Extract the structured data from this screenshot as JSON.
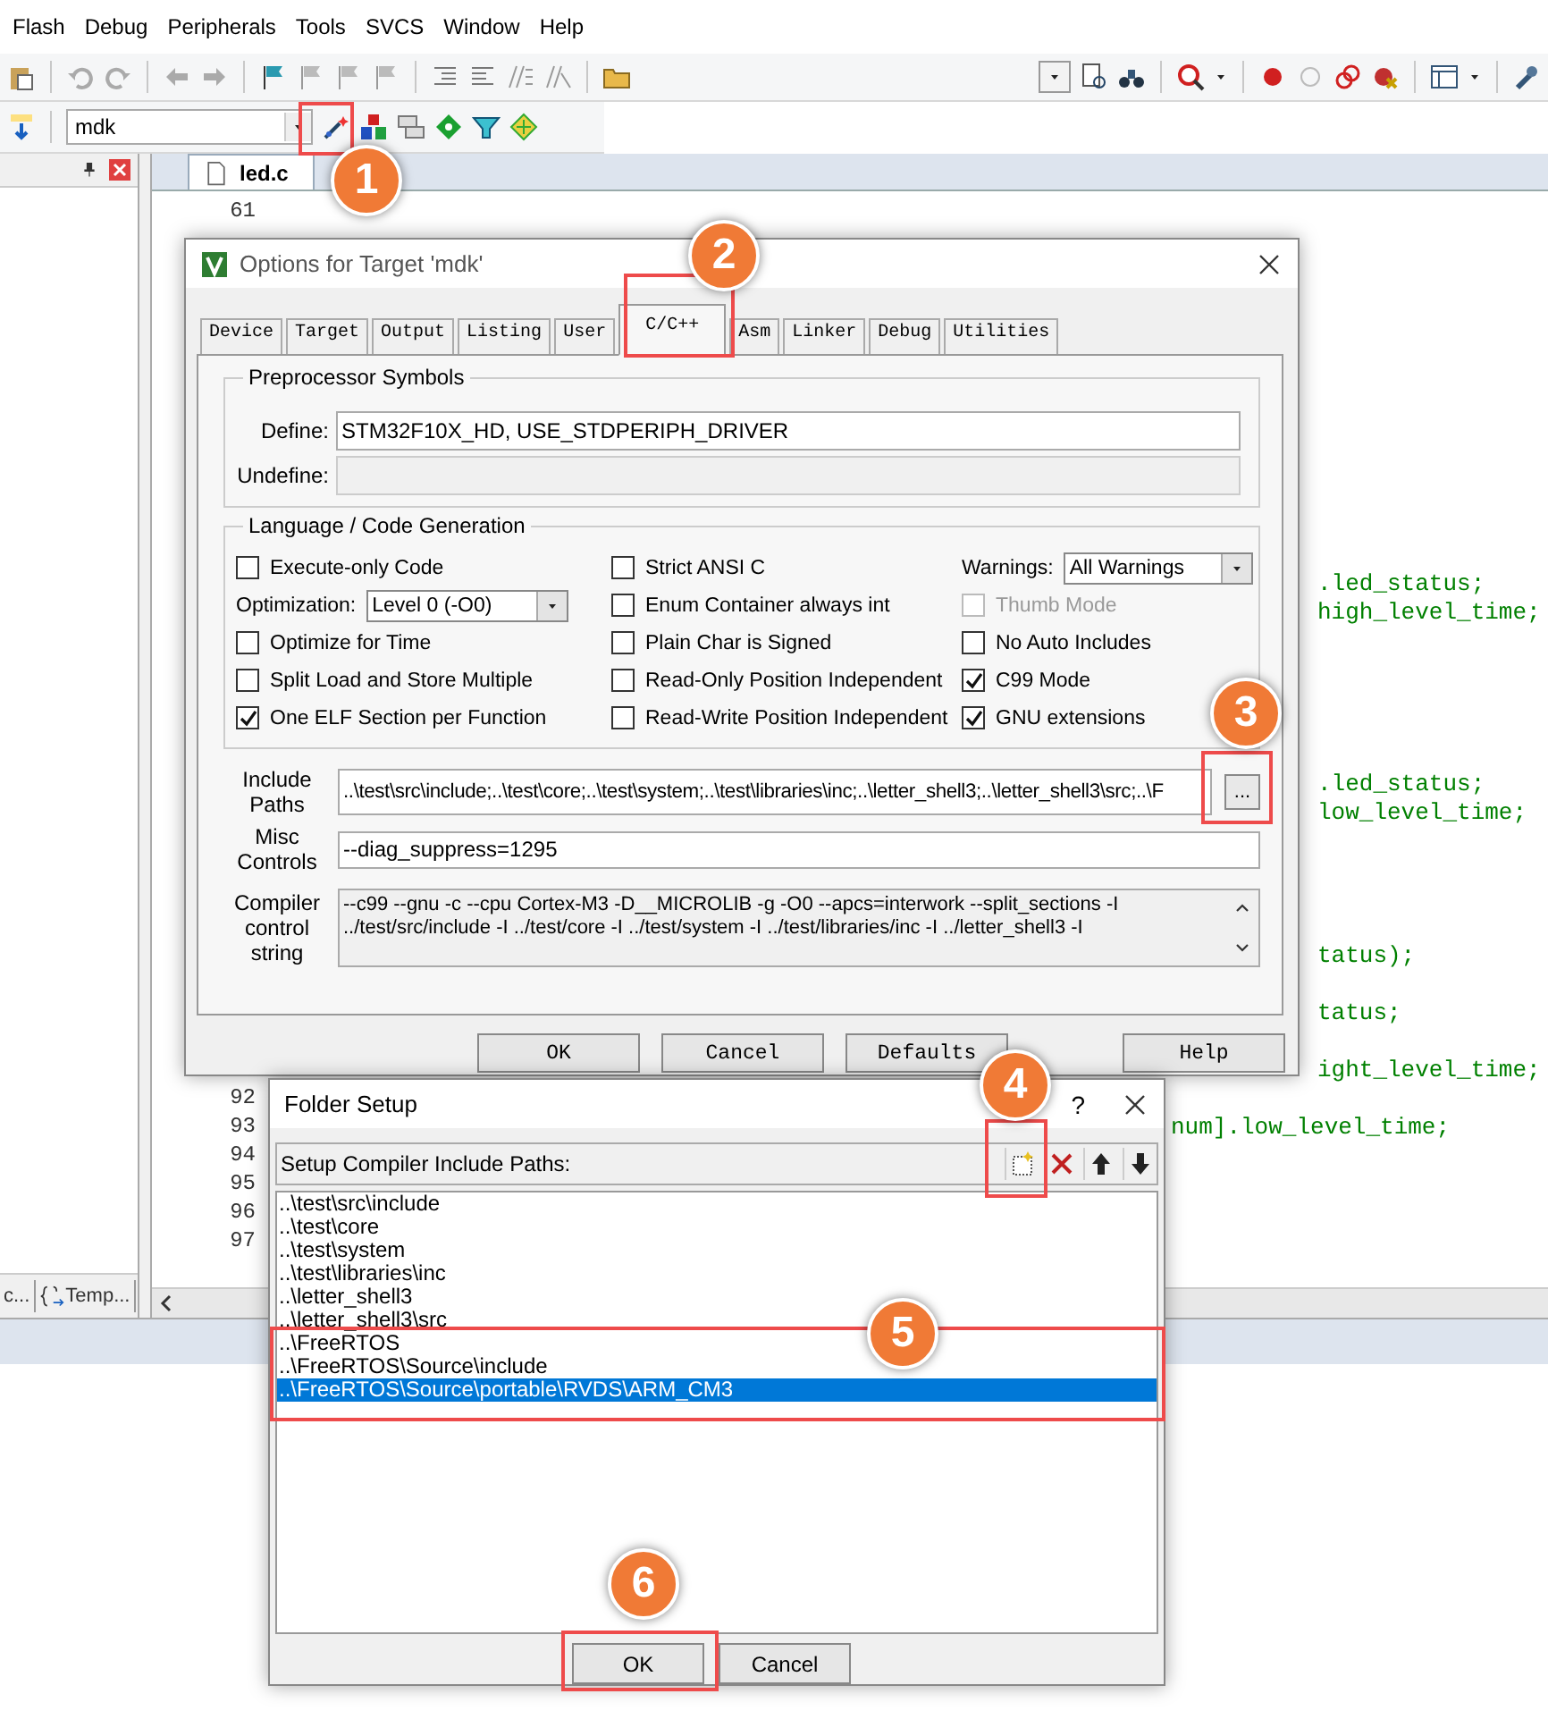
{
  "menu_bar": [
    "Flash",
    "Debug",
    "Peripherals",
    "Tools",
    "SVCS",
    "Window",
    "Help"
  ],
  "target_select": {
    "value": "mdk"
  },
  "project_panel": {
    "tabs": [
      "c...",
      "Temp..."
    ]
  },
  "editor": {
    "tab": "led.c",
    "lines": [
      {
        "number": "61"
      },
      {
        "code": ".led_status;",
        "kind": "right"
      },
      {
        "code": "high_level_time;",
        "kind": "right"
      },
      {
        "code": ".led_status;",
        "kind": "right"
      },
      {
        "code": "low_level_time;",
        "kind": "right"
      },
      {
        "code": "tatus);",
        "kind": "right"
      },
      {
        "code": "tatus;",
        "kind": "right"
      },
      {
        "code": "ight_level_time;",
        "kind": "right"
      },
      {
        "number": "92"
      },
      {
        "number": "93",
        "code": "num].low_level_time;",
        "kind": "mid"
      },
      {
        "number": "94"
      },
      {
        "number": "95"
      },
      {
        "number": "96"
      },
      {
        "number": "97"
      }
    ]
  },
  "options_dialog": {
    "title": "Options for Target 'mdk'",
    "tabs": [
      {
        "label": "Device",
        "selected": false
      },
      {
        "label": "Target",
        "selected": false
      },
      {
        "label": "Output",
        "selected": false
      },
      {
        "label": "Listing",
        "selected": false
      },
      {
        "label": "User",
        "selected": false
      },
      {
        "label": "C/C++",
        "selected": true
      },
      {
        "label": "Asm",
        "selected": false
      },
      {
        "label": "Linker",
        "selected": false
      },
      {
        "label": "Debug",
        "selected": false
      },
      {
        "label": "Utilities",
        "selected": false
      }
    ],
    "preprocessor": {
      "title": "Preprocessor Symbols",
      "define": {
        "label": "Define:",
        "value": "STM32F10X_HD, USE_STDPERIPH_DRIVER"
      },
      "undefine": {
        "label": "Undefine:",
        "disabled": true
      }
    },
    "language": {
      "title": "Language / Code Generation",
      "columns": [
        [
          {
            "kind": "checkbox",
            "label": "Execute-only Code",
            "checked": false,
            "disabled": false
          },
          {
            "kind": "dropdown",
            "label": "Optimization:",
            "value": "Level 0 (-O0)"
          },
          {
            "kind": "checkbox",
            "label": "Optimize for Time",
            "checked": false,
            "disabled": false
          },
          {
            "kind": "checkbox",
            "label": "Split Load and Store Multiple",
            "checked": false,
            "disabled": false
          },
          {
            "kind": "checkbox",
            "label": "One ELF Section per Function",
            "checked": true,
            "disabled": false
          }
        ],
        [
          {
            "kind": "checkbox",
            "label": "Strict ANSI C",
            "checked": false,
            "disabled": false
          },
          {
            "kind": "checkbox",
            "label": "Enum Container always int",
            "checked": false,
            "disabled": false
          },
          {
            "kind": "checkbox",
            "label": "Plain Char is Signed",
            "checked": false,
            "disabled": false
          },
          {
            "kind": "checkbox",
            "label": "Read-Only Position Independent",
            "checked": false,
            "disabled": false
          },
          {
            "kind": "checkbox",
            "label": "Read-Write Position Independent",
            "checked": false,
            "disabled": false
          }
        ],
        [
          {
            "kind": "dropdown",
            "label": "Warnings:",
            "value": "All Warnings"
          },
          {
            "kind": "checkbox",
            "label": "Thumb Mode",
            "checked": false,
            "disabled": true
          },
          {
            "kind": "checkbox",
            "label": "No Auto Includes",
            "checked": false,
            "disabled": false
          },
          {
            "kind": "checkbox",
            "label": "C99 Mode",
            "checked": true,
            "disabled": false
          },
          {
            "kind": "checkbox",
            "label": "GNU extensions",
            "checked": true,
            "disabled": false
          }
        ]
      ]
    },
    "include_paths": {
      "label": "Include Paths",
      "value": "..\\test\\src\\include;..\\test\\core;..\\test\\system;..\\test\\libraries\\inc;..\\letter_shell3;..\\letter_shell3\\src;..\\F",
      "button": "..."
    },
    "misc_controls": {
      "label": "Misc Controls",
      "value": "--diag_suppress=1295"
    },
    "compiler_string": {
      "label": "Compiler control string",
      "lines": [
        "--c99 --gnu -c --cpu Cortex-M3 -D__MICROLIB -g -O0 --apcs=interwork --split_sections -I",
        "../test/src/include -I ../test/core -I ../test/system -I ../test/libraries/inc -I ../letter_shell3 -I"
      ]
    },
    "buttons": [
      "OK",
      "Cancel",
      "Defaults",
      "Help"
    ]
  },
  "folder_dialog": {
    "title": "Folder Setup",
    "help": "?",
    "label": "Setup Compiler Include Paths:",
    "paths": [
      {
        "text": "..\\test\\src\\include",
        "selected": false
      },
      {
        "text": "..\\test\\core",
        "selected": false
      },
      {
        "text": "..\\test\\system",
        "selected": false
      },
      {
        "text": "..\\test\\libraries\\inc",
        "selected": false
      },
      {
        "text": "..\\letter_shell3",
        "selected": false
      },
      {
        "text": "..\\letter_shell3\\src",
        "selected": false
      },
      {
        "text": "..\\FreeRTOS",
        "selected": false
      },
      {
        "text": "..\\FreeRTOS\\Source\\include",
        "selected": false
      },
      {
        "text": "..\\FreeRTOS\\Source\\portable\\RVDS\\ARM_CM3",
        "selected": true
      }
    ],
    "buttons": [
      "OK",
      "Cancel"
    ]
  },
  "annotations": [
    "1",
    "2",
    "3",
    "4",
    "5",
    "6"
  ]
}
